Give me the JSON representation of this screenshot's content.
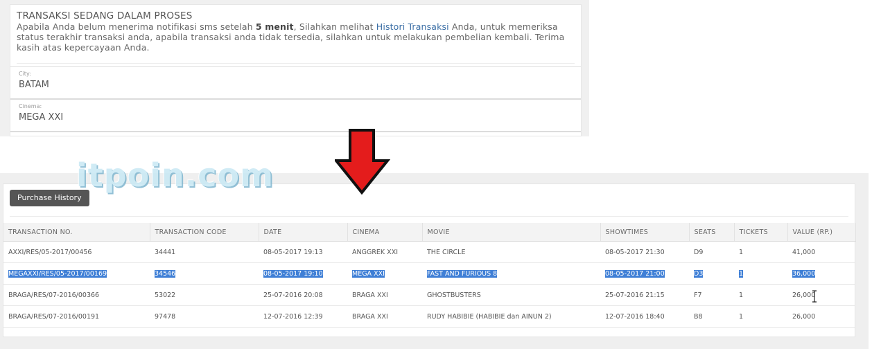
{
  "notice": {
    "title": "TRANSAKSI SEDANG DALAM PROSES",
    "text_part1": "Apabila Anda belum menerima notifikasi sms setelah ",
    "text_bold": "5 menit",
    "text_part2": ", Silahkan melihat ",
    "text_link": "Histori Transaksi",
    "text_part3": " Anda, untuk memeriksa status terakhir transaksi anda, apabila transaksi anda tidak tersedia, silahkan untuk melakukan pembelian kembali. Terima kasih atas kepercayaan Anda."
  },
  "form": {
    "city": {
      "label": "City:",
      "value": "BATAM"
    },
    "cinema": {
      "label": "Cinema:",
      "value": "MEGA XXI"
    }
  },
  "watermark": "itpoin.com",
  "history": {
    "button_label": "Purchase History",
    "columns": [
      "TRANSACTION NO.",
      "TRANSACTION CODE",
      "DATE",
      "CINEMA",
      "MOVIE",
      "SHOWTIMES",
      "SEATS",
      "TICKETS",
      "VALUE (RP.)"
    ],
    "rows": [
      [
        "AXXI/RES/05-2017/00456",
        "34441",
        "08-05-2017 19:13",
        "ANGGREK XXI",
        "THE CIRCLE",
        "08-05-2017 21:30",
        "D9",
        "1",
        "41,000"
      ],
      [
        "MEGAXXI/RES/05-2017/00169",
        "34546",
        "08-05-2017 19:10",
        "MEGA XXI",
        "FAST AND FURIOUS 8",
        "08-05-2017 21:00",
        "D3",
        "1",
        "36,000"
      ],
      [
        "BRAGA/RES/07-2016/00366",
        "53022",
        "25-07-2016 20:08",
        "BRAGA XXI",
        "GHOSTBUSTERS",
        "25-07-2016 21:15",
        "F7",
        "1",
        "26,000"
      ],
      [
        "BRAGA/RES/07-2016/00191",
        "97478",
        "12-07-2016 12:39",
        "BRAGA XXI",
        "RUDY HABIBIE (HABIBIE dan AINUN 2)",
        "12-07-2016 18:40",
        "B8",
        "1",
        "26,000"
      ]
    ],
    "selected_row": 1
  },
  "colors": {
    "selection": "#3f7fd6",
    "arrow": "#e41c1c",
    "button_bg": "#555555"
  },
  "icons": [
    "down-arrow-icon",
    "text-cursor-icon"
  ]
}
